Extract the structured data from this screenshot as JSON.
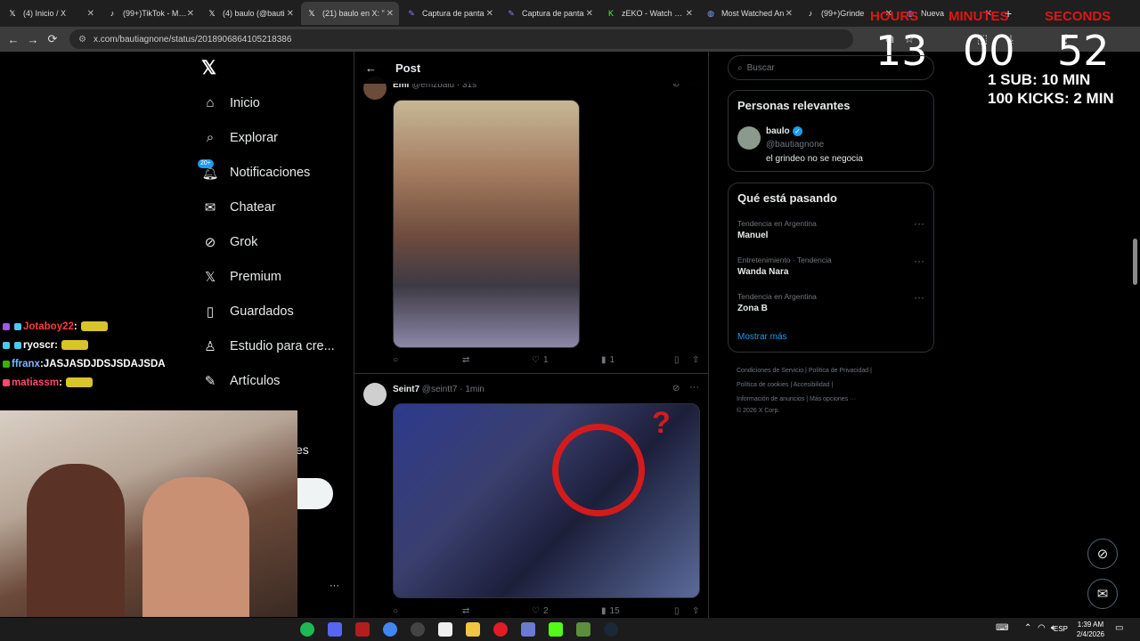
{
  "browser": {
    "tabs": [
      {
        "title": "(4) Inicio / X",
        "icon": "x",
        "color": "#ffffff"
      },
      {
        "title": "(99+)TikTok - Mak",
        "icon": "tiktok",
        "color": "#ffffff"
      },
      {
        "title": "(4) baulo (@bauti",
        "icon": "x",
        "color": "#ffffff"
      },
      {
        "title": "(21) baulo en X: \"",
        "icon": "x",
        "color": "#ffffff",
        "active": true
      },
      {
        "title": "Captura de panta",
        "icon": "pen",
        "color": "#8a7cff"
      },
      {
        "title": "Captura de panta",
        "icon": "pen",
        "color": "#8a7cff"
      },
      {
        "title": "zEKO - Watch clip",
        "icon": "kick",
        "color": "#53fc18"
      },
      {
        "title": "Most Watched An",
        "icon": "globe",
        "color": "#7aa7ff"
      },
      {
        "title": "(99+)Grinde",
        "icon": "tiktok",
        "color": "#ffffff"
      },
      {
        "title": "Nueva",
        "icon": "globe",
        "color": "#7aa7ff"
      }
    ],
    "new_tab": "+",
    "url": "x.com/bautiagnone/status/2018906864105218386"
  },
  "timer": {
    "labels": {
      "hours": "HOURS",
      "minutes": "MINUTES",
      "seconds": "SECONDS"
    },
    "hours": "13",
    "minutes": "00",
    "seconds": "52",
    "line1": "1 SUB: 10 MIN",
    "line2": "100 KICKS: 2 MIN"
  },
  "nav": {
    "items": [
      {
        "label": "Inicio",
        "icon": "home-icon"
      },
      {
        "label": "Explorar",
        "icon": "search-icon"
      },
      {
        "label": "Notificaciones",
        "icon": "bell-icon",
        "badge": "20+"
      },
      {
        "label": "Chatear",
        "icon": "mail-icon"
      },
      {
        "label": "Grok",
        "icon": "grok-icon"
      },
      {
        "label": "Premium",
        "icon": "x-icon"
      },
      {
        "label": "Guardados",
        "icon": "bookmark-icon"
      },
      {
        "label": "Estudio para cre...",
        "icon": "studio-icon"
      },
      {
        "label": "Artículos",
        "icon": "article-icon"
      }
    ],
    "more_dots": "···",
    "partial_text": "es"
  },
  "main": {
    "header": "Post",
    "tweets": [
      {
        "name": "Emi",
        "handle": "@emzbalu",
        "time": "31s",
        "replies": "",
        "reposts": "",
        "likes": "1",
        "views": "1"
      },
      {
        "name": "Seint7",
        "handle": "@seintt7",
        "time": "1min",
        "replies": "",
        "reposts": "",
        "likes": "2",
        "views": "15"
      }
    ]
  },
  "right": {
    "search_placeholder": "Buscar",
    "relevant": {
      "title": "Personas relevantes",
      "name": "baulo",
      "handle": "@bautiagnone",
      "bio": "el grindeo no se negocia"
    },
    "trends": {
      "title": "Qué está pasando",
      "items": [
        {
          "meta": "Tendencia en Argentina",
          "name": "Manuel"
        },
        {
          "meta": "Entretenimiento · Tendencia",
          "name": "Wanda Nara"
        },
        {
          "meta": "Tendencia en Argentina",
          "name": "Zona B"
        }
      ],
      "more": "Mostrar más"
    },
    "footer": {
      "line1a": "Condiciones de Servicio",
      "line1b": "Política de Privacidad",
      "line2a": "Política de cookies",
      "line2b": "Accesibilidad",
      "line3a": "Información de anuncios",
      "line3b": "Más opciones ···",
      "line4": "© 2026 X Corp."
    }
  },
  "chat": [
    {
      "user": "Jotaboy22",
      "message": "",
      "color": "#ff3b3b"
    },
    {
      "user": "ryoscr",
      "message": "",
      "color": "#ffffff"
    },
    {
      "user": "ffranx",
      "message": "JASJASDJDSJSDAJSDA",
      "color": "#7ab8ff"
    },
    {
      "user": "matiassm",
      "message": "",
      "color": "#ff4a6a"
    }
  ],
  "taskbar": {
    "lang": "ESP",
    "time": "1:39 AM",
    "date": "2/4/2026"
  }
}
